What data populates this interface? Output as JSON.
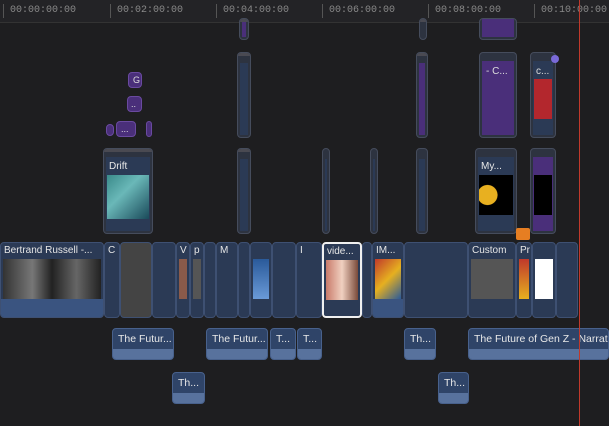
{
  "ruler": {
    "timecodes": [
      "00:00:00:00",
      "00:02:00:00",
      "00:04:00:00",
      "00:06:00:00",
      "00:08:00:00",
      "00:10:00:00"
    ]
  },
  "connected_clips": {
    "drift": "Drift",
    "c_dash": "- C...",
    "c_short": "c...",
    "my": "My...",
    "g_marker": "G",
    "dots1": "..",
    "dots2": "..."
  },
  "primary_clips": {
    "bertrand": "Bertrand Russell -...",
    "c": "C",
    "v": "V",
    "p": "p",
    "m": "M",
    "i": "I",
    "video": "vide...",
    "im": "IM...",
    "custom": "Custom",
    "pr": "Pr"
  },
  "audio_clips": {
    "future1": "The Futur...",
    "future2": "The Futur...",
    "t1": "T...",
    "t2": "T...",
    "th1": "Th...",
    "gen_z": "The Future of Gen Z - Narrat",
    "th2": "Th...",
    "th3": "Th..."
  },
  "colors": {
    "playhead": "#c0392b",
    "purple_clip": "#4a2f7a",
    "video_clip": "#2b3a55",
    "audio_clip": "#2f4468"
  }
}
